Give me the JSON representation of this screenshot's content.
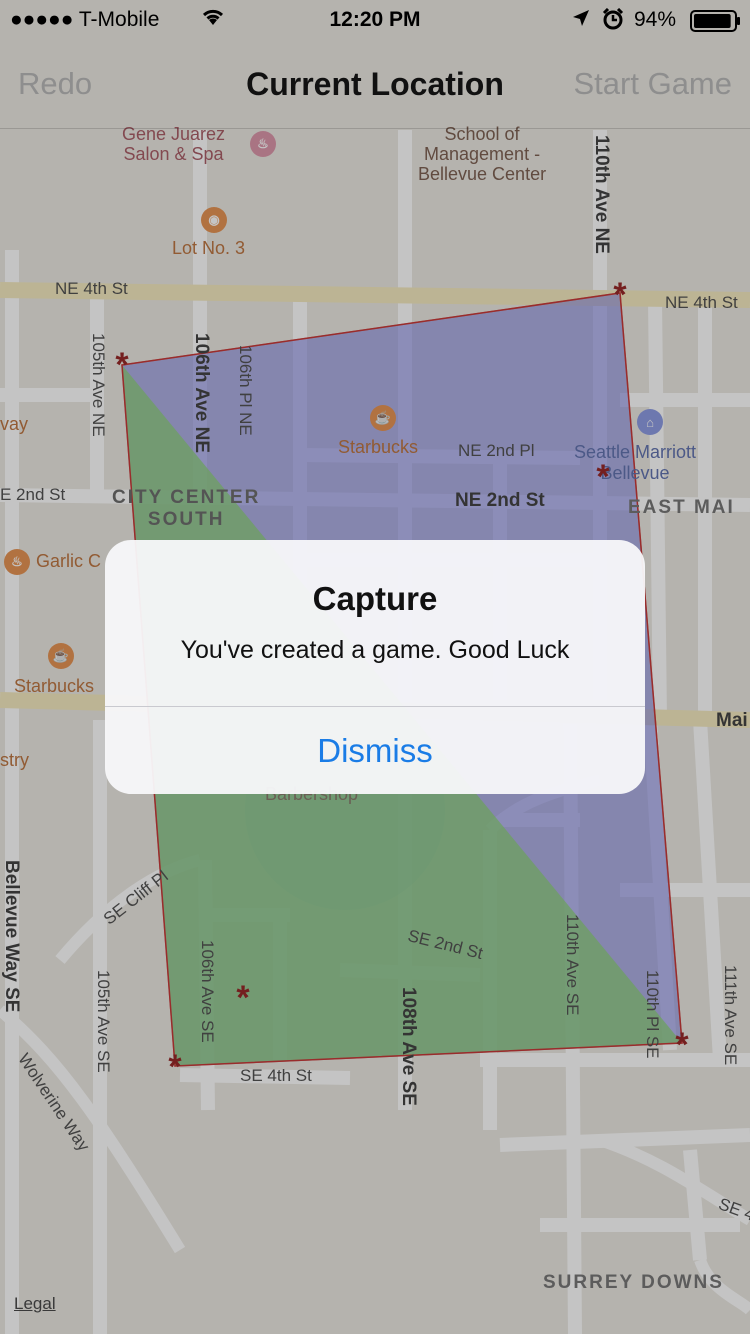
{
  "status_bar": {
    "carrier": "●●●●● T-Mobile",
    "time": "12:20 PM",
    "battery_percent": "94%",
    "battery_level": 0.94,
    "wifi_icon": "wifi-icon",
    "location_icon": "location-arrow-icon",
    "alarm_icon": "alarm-icon"
  },
  "nav": {
    "left_button": "Redo",
    "title": "Current Location",
    "right_button": "Start Game"
  },
  "map": {
    "poi": {
      "gene_juarez": "Gene Juarez\nSalon & Spa",
      "school": "School of\nManagement -\nBellevue Center",
      "lot3": "Lot No. 3",
      "starbucks_1": "Starbucks",
      "starbucks_2": "Starbucks",
      "seattle_marriott": "Seattle Marriott\nBellevue",
      "garlic": "Garlic C",
      "barbershop": "Barbershop",
      "stry": "stry",
      "way": "vay"
    },
    "districts": {
      "city_center_south": "CITY CENTER\nSOUTH",
      "east_main": "EAST MAI",
      "surrey_downs": "SURREY DOWNS"
    },
    "streets": {
      "ne4th_left": "NE 4th St",
      "ne4th_right": "NE 4th St",
      "ne2nd_pl": "NE 2nd Pl",
      "ne2nd_st": "NE 2nd St",
      "e2nd_st": "E 2nd St",
      "main": "Mai",
      "ave110_ne": "110th Ave NE",
      "ave105_ne": "105th Ave NE",
      "ave106_ne": "106th Ave NE",
      "pl106_ne": "106th Pl NE",
      "se_cliff_pl": "SE Cliff Pl",
      "se_2nd_st": "SE 2nd St",
      "se_4th_st": "SE 4th St",
      "ave106_se": "106th Ave SE",
      "ave105_se": "105th Ave SE",
      "ave108_se": "108th Ave SE",
      "ave110_se": "110th Ave SE",
      "pl110_se": "110th Pl SE",
      "ave111_se": "111th Ave SE",
      "bellevue_way": "Bellevue Way SE",
      "wolverine_way": "Wolverine Way",
      "se4_right": "SE 4"
    },
    "legal": "Legal",
    "colors": {
      "green_region": "#7fcb6a",
      "blue_region": "#6b6fe0",
      "marker": "#8a0c0c"
    }
  },
  "alert": {
    "title": "Capture",
    "message": "You've created a game. Good Luck",
    "dismiss": "Dismiss"
  }
}
